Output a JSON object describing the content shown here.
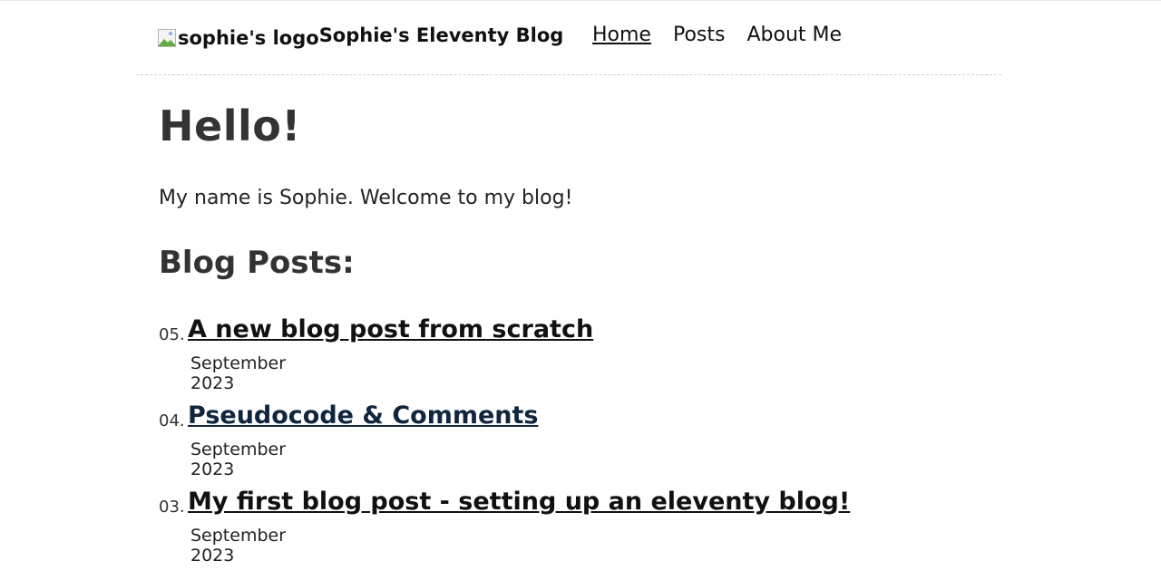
{
  "header": {
    "logo_alt": "sophie's logo",
    "site_title": "Sophie's Eleventy Blog",
    "nav": [
      {
        "label": "Home",
        "active": true
      },
      {
        "label": "Posts",
        "active": false
      },
      {
        "label": "About Me",
        "active": false
      }
    ]
  },
  "main": {
    "heading": "Hello!",
    "intro": "My name is Sophie. Welcome to my blog!",
    "posts_heading": "Blog Posts:",
    "posts": [
      {
        "number": "05.",
        "title": "A new blog post from scratch",
        "date": "September 2023"
      },
      {
        "number": "04.",
        "title": "Pseudocode & Comments",
        "date": "September 2023"
      },
      {
        "number": "03.",
        "title": "My first blog post - setting up an eleventy blog!",
        "date": "September 2023"
      }
    ]
  },
  "colors": {
    "text": "#222222",
    "visited_link": "#10263e",
    "divider": "#cfcfcf"
  }
}
